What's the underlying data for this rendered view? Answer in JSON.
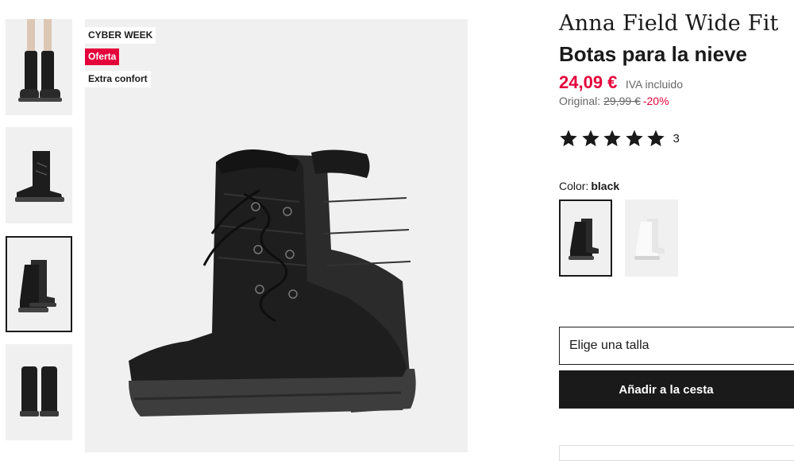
{
  "badges": {
    "cyber_week": "CYBER WEEK",
    "offer": "Oferta",
    "comfort": "Extra confort"
  },
  "product": {
    "brand": "Anna Field Wide Fit",
    "name": "Botas para la nieve",
    "price": "24,09 €",
    "vat_note": "IVA incluido",
    "original_label": "Original:",
    "original_price": "29,99 €",
    "discount": "-20%",
    "rating_stars": 5,
    "rating_count": "3",
    "color_label": "Color:",
    "color_value": "black"
  },
  "thumbnails": [
    {
      "name": "boots-worn",
      "selected": false
    },
    {
      "name": "boot-side",
      "selected": false
    },
    {
      "name": "boots-pair",
      "selected": true
    },
    {
      "name": "boots-back",
      "selected": false
    }
  ],
  "swatches": [
    {
      "name": "black",
      "selected": true
    },
    {
      "name": "white",
      "selected": false
    }
  ],
  "actions": {
    "size_placeholder": "Elige una talla",
    "add_to_cart": "Añadir a la cesta"
  },
  "colors": {
    "accent": "#e4003a",
    "dark": "#1a1a1a",
    "image_bg": "#f0f0f0"
  }
}
